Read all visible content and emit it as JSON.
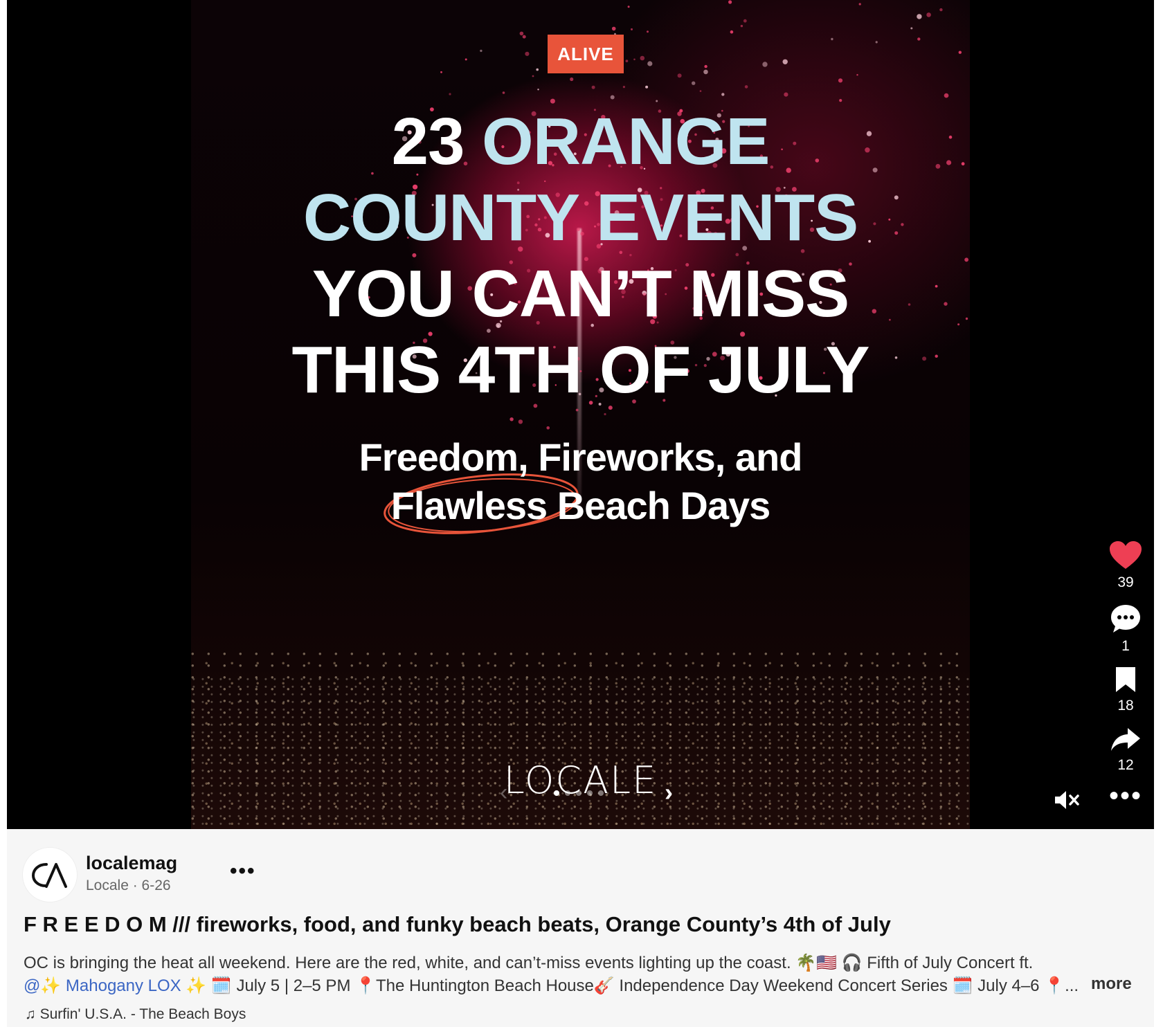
{
  "poster": {
    "badge": "ALIVE",
    "headline": {
      "line1_num": "23",
      "line1_hl": "ORANGE",
      "line2": "COUNTY EVENTS",
      "line3": "YOU CAN’T MISS",
      "line4": "THIS 4TH OF JULY"
    },
    "sub": {
      "line1": "Freedom, Fireworks, and",
      "line2": "Flawless Beach Days"
    },
    "brand": "LOCALE",
    "colors": {
      "badge": "#e8543a",
      "highlight": "#bfe4ef",
      "circle": "#e8543a"
    }
  },
  "carousel": {
    "slides": 5,
    "current": 1,
    "prev_icon": "chevron-left-icon",
    "next_icon": "chevron-right-icon"
  },
  "actions": {
    "like": {
      "icon": "heart-icon",
      "count": "39",
      "color": "#ee3f54"
    },
    "comment": {
      "icon": "comment-icon",
      "count": "1"
    },
    "save": {
      "icon": "bookmark-icon",
      "count": "18"
    },
    "share": {
      "icon": "share-icon",
      "count": "12"
    },
    "mute_icon": "muted-speaker-icon",
    "more": "•••"
  },
  "post": {
    "username": "localemag",
    "meta": "Locale · 6-26",
    "more": "•••",
    "title": "F R E E D O M /// fireworks, food, and funky beach beats, Orange County’s 4th of July",
    "body_line1": "OC is bringing the heat all weekend. Here are the red, white, and can’t-miss events lighting up the coast. 🌴🇺🇸 🎧 Fifth of July Concert ft.",
    "mention": "@✨ Mahogany LOX",
    "body_line2_rest": " ✨ 🗓️ July 5 | 2–5 PM 📍The Huntington Beach House🎸 Independence Day Weekend Concert Series 🗓️ July 4–6 📍...",
    "read_more": "more",
    "music_icon": "music-note-icon",
    "music": "Surfin' U.S.A. - The Beach Boys"
  }
}
